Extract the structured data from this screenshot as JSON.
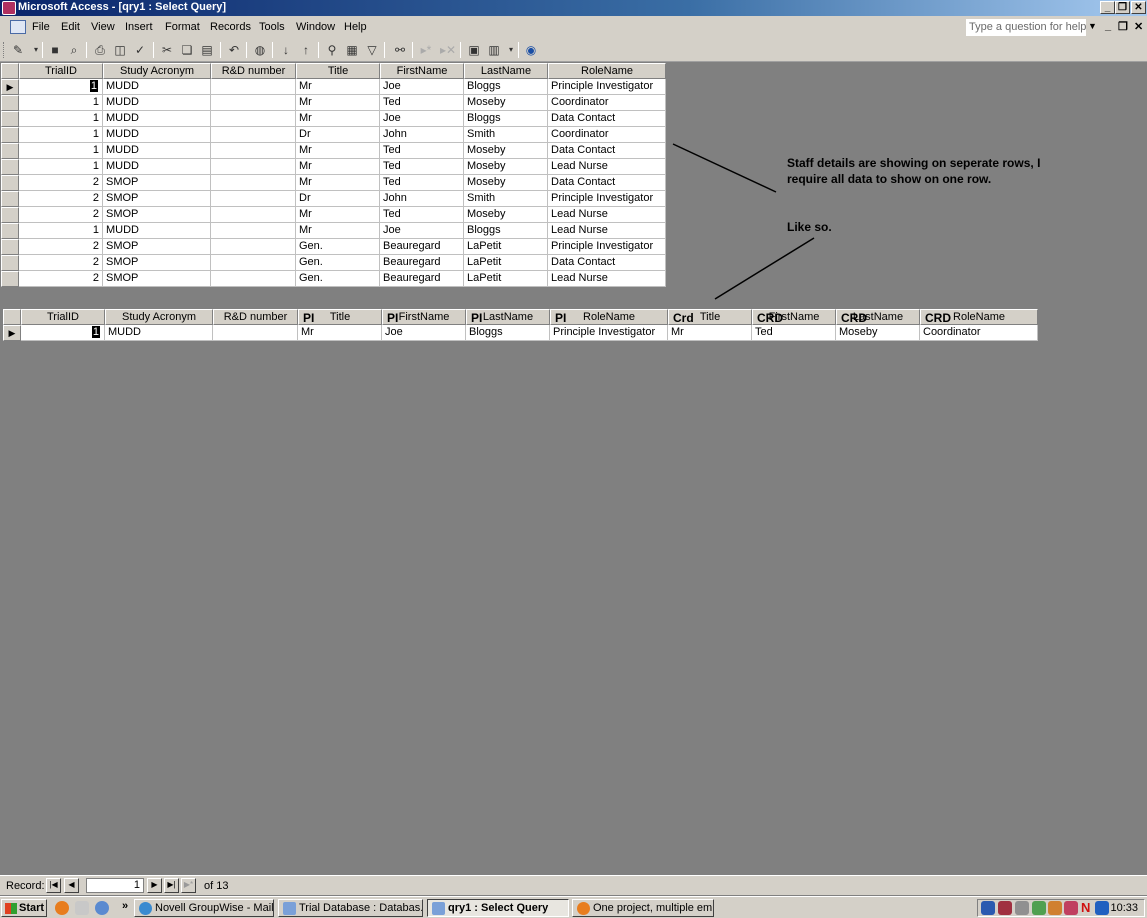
{
  "window": {
    "title": "Microsoft Access - [qry1 : Select Query]"
  },
  "menu": {
    "items": [
      "File",
      "Edit",
      "View",
      "Insert",
      "Format",
      "Records",
      "Tools",
      "Window",
      "Help"
    ],
    "help_placeholder": "Type a question for help"
  },
  "icons": {
    "toolbar": [
      "view-icon",
      "save-icon",
      "search-icon",
      "print-icon",
      "print-preview-icon",
      "spelling-icon",
      "cut-icon",
      "copy-icon",
      "paste-icon",
      "undo-icon",
      "hyperlink-icon",
      "sort-ascending-icon",
      "sort-descending-icon",
      "filter-selection-icon",
      "filter-form-icon",
      "apply-filter-icon",
      "find-icon",
      "new-record-icon",
      "delete-record-icon",
      "database-window-icon",
      "new-object-icon",
      "help-icon"
    ]
  },
  "query1": {
    "headers": [
      "TrialID",
      "Study Acronym",
      "R&D number",
      "Title",
      "FirstName",
      "LastName",
      "RoleName"
    ],
    "rows": [
      [
        "1",
        "MUDD",
        "",
        "Mr",
        "Joe",
        "Bloggs",
        "Principle Investigator"
      ],
      [
        "1",
        "MUDD",
        "",
        "Mr",
        "Ted",
        "Moseby",
        "Coordinator"
      ],
      [
        "1",
        "MUDD",
        "",
        "Mr",
        "Joe",
        "Bloggs",
        "Data Contact"
      ],
      [
        "1",
        "MUDD",
        "",
        "Dr",
        "John",
        "Smith",
        "Coordinator"
      ],
      [
        "1",
        "MUDD",
        "",
        "Mr",
        "Ted",
        "Moseby",
        "Data Contact"
      ],
      [
        "1",
        "MUDD",
        "",
        "Mr",
        "Ted",
        "Moseby",
        "Lead Nurse"
      ],
      [
        "2",
        "SMOP",
        "",
        "Mr",
        "Ted",
        "Moseby",
        "Data Contact"
      ],
      [
        "2",
        "SMOP",
        "",
        "Dr",
        "John",
        "Smith",
        "Principle Investigator"
      ],
      [
        "2",
        "SMOP",
        "",
        "Mr",
        "Ted",
        "Moseby",
        "Lead Nurse"
      ],
      [
        "1",
        "MUDD",
        "",
        "Mr",
        "Joe",
        "Bloggs",
        "Lead Nurse"
      ],
      [
        "2",
        "SMOP",
        "",
        "Gen.",
        "Beauregard",
        "LaPetit",
        "Principle Investigator"
      ],
      [
        "2",
        "SMOP",
        "",
        "Gen.",
        "Beauregard",
        "LaPetit",
        "Data Contact"
      ],
      [
        "2",
        "SMOP",
        "",
        "Gen.",
        "Beauregard",
        "LaPetit",
        "Lead Nurse"
      ]
    ]
  },
  "query2": {
    "headers": [
      {
        "prefix": "",
        "label": "TrialID"
      },
      {
        "prefix": "",
        "label": "Study Acronym"
      },
      {
        "prefix": "",
        "label": "R&D number"
      },
      {
        "prefix": "PI",
        "label": "Title"
      },
      {
        "prefix": "PI",
        "label": "FirstName"
      },
      {
        "prefix": "PI",
        "label": "LastName"
      },
      {
        "prefix": "PI",
        "label": "RoleName"
      },
      {
        "prefix": "Crd",
        "label": "Title"
      },
      {
        "prefix": "CRD",
        "label": "FirstName"
      },
      {
        "prefix": "CRD",
        "label": "LastName"
      },
      {
        "prefix": "CRD",
        "label": "RoleName"
      }
    ],
    "row": [
      "1",
      "MUDD",
      "",
      "Mr",
      "Joe",
      "Bloggs",
      "Principle Investigator",
      "Mr",
      "Ted",
      "Moseby",
      "Coordinator"
    ]
  },
  "annotations": {
    "note1": "Staff details are showing on seperate rows, I require all data to show on one row.",
    "note2": "Like so."
  },
  "record_nav": {
    "label": "Record:",
    "current": "1",
    "total_text": "of 13"
  },
  "taskbar": {
    "start": "Start",
    "chevron": "»",
    "buttons": [
      "Novell GroupWise - Mailbox",
      "Trial Database : Databas...",
      "qry1 : Select Query",
      "One project, multiple em..."
    ],
    "clock": "10:33"
  }
}
